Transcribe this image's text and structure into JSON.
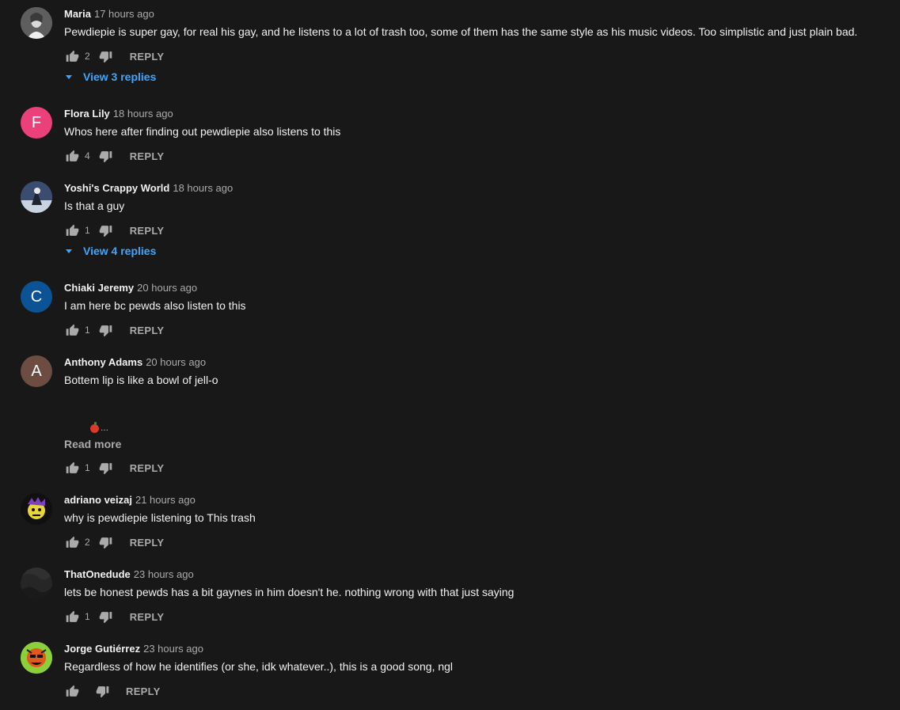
{
  "icons": {
    "like": "thumb-up-icon",
    "dislike": "thumb-down-icon",
    "expand": "caret-down-icon"
  },
  "reply_label": "REPLY",
  "comments": [
    {
      "author": "Maria",
      "time": "17 hours ago",
      "text": "Pewdiepie is super gay, for real his gay, and he listens to a lot of trash too, some of them has the same style as his music videos. Too simplistic and just plain bad.",
      "likes": "2",
      "replies_label": "View 3 replies",
      "avatar": {
        "type": "image",
        "color": "#8c8c8c"
      }
    },
    {
      "author": "Flora Lily",
      "time": "18 hours ago",
      "text": "Whos here after finding out pewdiepie also listens to this",
      "likes": "4",
      "avatar": {
        "type": "letter",
        "letter": "F",
        "color": "#ec407a"
      }
    },
    {
      "author": "Yoshi's Crappy World",
      "time": "18 hours ago",
      "text": "Is that a guy",
      "likes": "1",
      "replies_label": "View 4 replies",
      "avatar": {
        "type": "image",
        "color": "#4a5a7a"
      }
    },
    {
      "author": "Chiaki Jeremy",
      "time": "20 hours ago",
      "text": "I am here bc pewds also listen to this",
      "likes": "1",
      "avatar": {
        "type": "letter",
        "letter": "C",
        "color": "#0b5394"
      }
    },
    {
      "author": "Anthony Adams",
      "time": "20 hours ago",
      "text": "Bottem lip is like a bowl of jell-o",
      "emoji_suffix": "...",
      "read_more": "Read more",
      "likes": "1",
      "avatar": {
        "type": "letter",
        "letter": "A",
        "color": "#6d4c41"
      }
    },
    {
      "author": "adriano veizaj",
      "time": "21 hours ago",
      "text": "why is pewdiepie listening to This trash",
      "likes": "2",
      "avatar": {
        "type": "image",
        "color": "#e8d53a"
      }
    },
    {
      "author": "ThatOnedude",
      "time": "23 hours ago",
      "text": "lets be honest pewds has a bit gaynes in him doesn't he. nothing wrong with that just saying",
      "likes": "1",
      "avatar": {
        "type": "image",
        "color": "#2a2a2a"
      }
    },
    {
      "author": "Jorge Gutiérrez",
      "time": "23 hours ago",
      "text": "Regardless of how he identifies (or she, idk whatever..), this is a good song, ngl",
      "likes": "",
      "avatar": {
        "type": "image",
        "color": "#7ac142"
      }
    }
  ]
}
